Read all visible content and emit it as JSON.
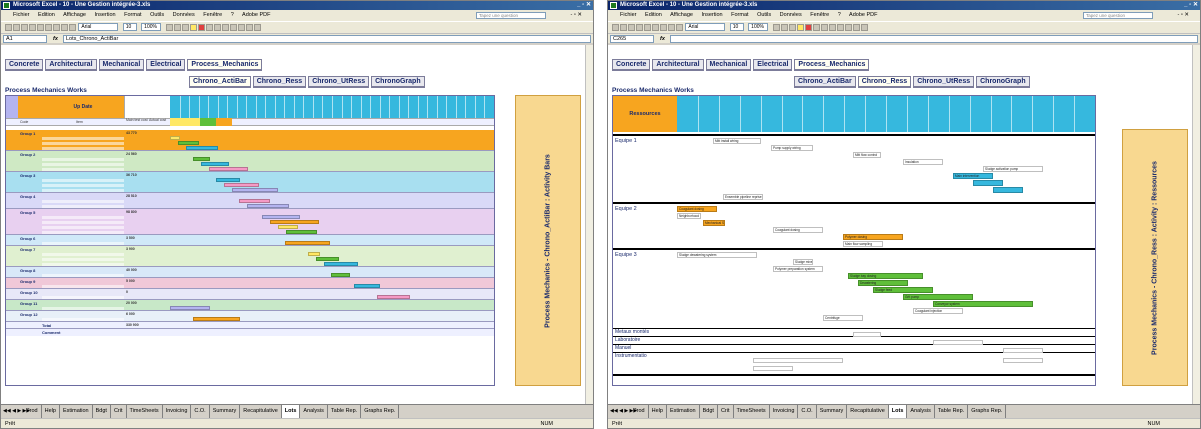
{
  "left": {
    "window_title": "Microsoft Excel - 10 - Une Gestion intégrée-3.xls",
    "menu": [
      "Fichier",
      "Edition",
      "Affichage",
      "Insertion",
      "Format",
      "Outils",
      "Données",
      "Fenêtre",
      "?",
      "Adobe PDF"
    ],
    "ask_placeholder": "Tapez une question",
    "font_name": "Arial",
    "font_size": "10",
    "zoom": "100%",
    "name_box": "A1",
    "formula": "Lots_Chrono_ActiBar",
    "nav_row1": [
      "Concrete",
      "Architectural",
      "Mechanical",
      "Electrical",
      "Process_Mechanics"
    ],
    "nav_row2": [
      "Chrono_ActiBar",
      "Chrono_Ress",
      "Chrono_UtRess",
      "ChronoGraph"
    ],
    "active_nav2": "Chrono_ActiBar",
    "sheet_title": "Process Mechanics Works",
    "header_date_label": "Up Date",
    "col_code": "Code",
    "col_item": "Item",
    "col_main_cost": "Main test cost",
    "col_actual_cost": "Actual cost",
    "side_label": "Process Mechanics - Chrono_ActiBar : Activity Bars",
    "row_total": "Total",
    "row_comment": "Comment",
    "groups": [
      {
        "name": "Group 1",
        "value": "43 770"
      },
      {
        "name": "Group 2",
        "value": "24 560"
      },
      {
        "name": "Group 3",
        "value": "36 710"
      },
      {
        "name": "Group 4",
        "value": "28 510"
      },
      {
        "name": "Group 5",
        "value": "98 800"
      },
      {
        "name": "Group 6",
        "value": "3 500"
      },
      {
        "name": "Group 7",
        "value": "3 900"
      },
      {
        "name": "Group 8",
        "value": "40 000"
      },
      {
        "name": "Group 9",
        "value": "5 000"
      },
      {
        "name": "Group 10",
        "value": "0"
      },
      {
        "name": "Group 11",
        "value": "20 000"
      },
      {
        "name": "Group 12",
        "value": "6 000"
      }
    ],
    "total_value": "330 900"
  },
  "right": {
    "window_title": "Microsoft Excel - 10 - Une Gestion intégrée-3.xls",
    "menu": [
      "Fichier",
      "Edition",
      "Affichage",
      "Insertion",
      "Format",
      "Outils",
      "Données",
      "Fenêtre",
      "?",
      "Adobe PDF"
    ],
    "ask_placeholder": "Tapez une question",
    "font_name": "Arial",
    "font_size": "10",
    "zoom": "100%",
    "name_box": "C265",
    "formula": "",
    "nav_row1": [
      "Concrete",
      "Architectural",
      "Mechanical",
      "Electrical",
      "Process_Mechanics"
    ],
    "nav_row2": [
      "Chrono_ActiBar",
      "Chrono_Ress",
      "Chrono_UtRess",
      "ChronoGraph"
    ],
    "active_nav2": "Chrono_Ress",
    "sheet_title": "Process Mechanics Works",
    "resources_label": "Ressources",
    "side_label": "Process Mechanics - Chrono_Ress : Activity : Ressources",
    "equipes": [
      "Equipe 1",
      "Equipe 2",
      "Equipe 3"
    ],
    "small_rows": [
      "Metaux montés",
      "Laboratoire",
      "Manuel",
      "Instrumentatio"
    ],
    "bar_labels": {
      "e1": [
        "Main intervention",
        "Mitt install wiring",
        "Ensemble pipeline reprise",
        "Pump supply wiring",
        "Mitt flow control",
        "Insulation",
        "Sludge activation pump"
      ],
      "e2": [
        "Coagulant dosing",
        "Neighborhood pump",
        "Mechanical Screen",
        "Coagulant dosing",
        "Polymer dosing",
        "Polymer dosing pump",
        "Polymer preparation system",
        "Main flow sampling"
      ],
      "e3": [
        "Sludge dewatering system",
        "Sludge mixer",
        "Polymer preparation system",
        "Sludge bay dosing",
        "Dewatering",
        "Sludge feed",
        "Centrifuge",
        "Grit pump",
        "Conveyor system",
        "Coagulant injection"
      ],
      "misc": [
        "Manuel",
        "Laboratory equipments",
        "Stage operation"
      ]
    }
  },
  "sheet_tabs": [
    "Prod",
    "Help",
    "Estimation",
    "Bdgt",
    "Crit",
    "TimeSheets",
    "Invoicing",
    "C.O.",
    "Summary",
    "Recapitulative",
    "Lots",
    "Analysis",
    "Table Rep.",
    "Graphs Rep."
  ],
  "active_tab": "Lots",
  "status_left": "Prêt",
  "status_num": "NUM",
  "colors": {
    "orange": "#f7a51f",
    "yellow": "#ffe866",
    "green": "#5fbf3a",
    "cyan": "#36b8de",
    "pink": "#f59ac5",
    "lavender": "#b4b4f0",
    "panel": "#f8d890"
  }
}
